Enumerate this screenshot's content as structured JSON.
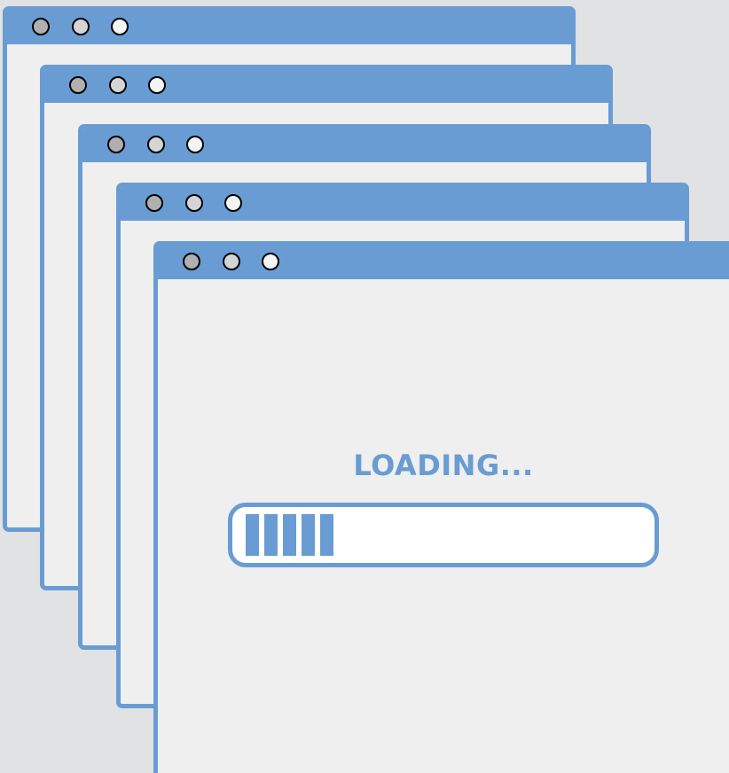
{
  "colors": {
    "accent": "#699cd3",
    "window_body": "#efefef",
    "background": "#e1e2e3",
    "dot_close": "#b0b0b0",
    "dot_minimize": "#d5d5d5",
    "dot_maximize": "#f4f4f4"
  },
  "windows": [
    {
      "id": "w1",
      "title_dots": [
        "dot-icon",
        "dot-icon",
        "dot-icon"
      ]
    },
    {
      "id": "w2",
      "title_dots": [
        "dot-icon",
        "dot-icon",
        "dot-icon"
      ]
    },
    {
      "id": "w3",
      "title_dots": [
        "dot-icon",
        "dot-icon",
        "dot-icon"
      ]
    },
    {
      "id": "w4",
      "title_dots": [
        "dot-icon",
        "dot-icon",
        "dot-icon"
      ]
    },
    {
      "id": "w5",
      "title_dots": [
        "dot-icon",
        "dot-icon",
        "dot-icon"
      ]
    }
  ],
  "loading": {
    "label": "LOADING...",
    "progress_segments": 5
  }
}
